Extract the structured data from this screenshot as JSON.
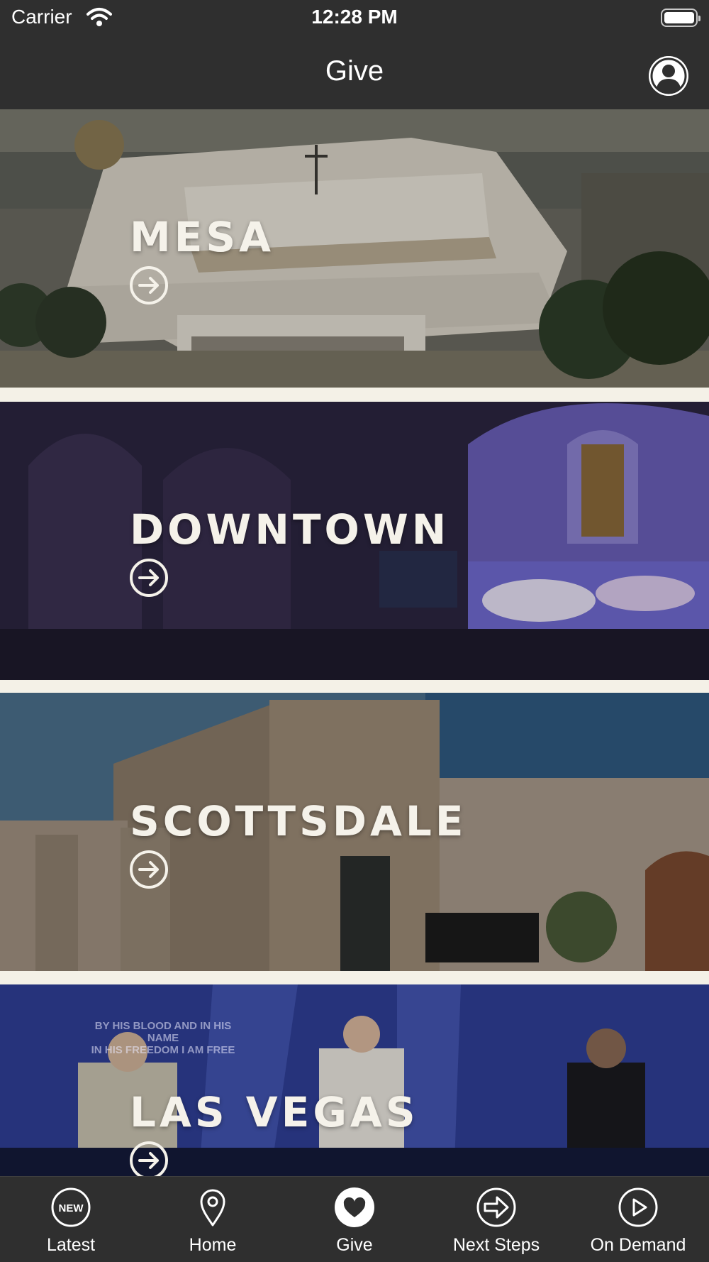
{
  "status_bar": {
    "carrier": "Carrier",
    "time": "12:28 PM"
  },
  "nav": {
    "title": "Give"
  },
  "campuses": [
    {
      "name": "MESA"
    },
    {
      "name": "DOWNTOWN"
    },
    {
      "name": "SCOTTSDALE"
    },
    {
      "name": "LAS VEGAS"
    }
  ],
  "las_vegas_screen_lyrics": "BY HIS BLOOD AND IN HIS NAME\nIN HIS FREEDOM I AM FREE",
  "tab_bar": {
    "items": [
      {
        "label": "Latest",
        "icon": "new-badge-icon",
        "badge_text": "NEW"
      },
      {
        "label": "Home",
        "icon": "location-pin-icon"
      },
      {
        "label": "Give",
        "icon": "heart-icon",
        "active": true
      },
      {
        "label": "Next Steps",
        "icon": "arrow-circle-icon"
      },
      {
        "label": "On Demand",
        "icon": "play-icon"
      }
    ]
  },
  "colors": {
    "bar_background": "#2f2f2f",
    "list_background": "#f4f1e7",
    "text": "#ffffff"
  }
}
